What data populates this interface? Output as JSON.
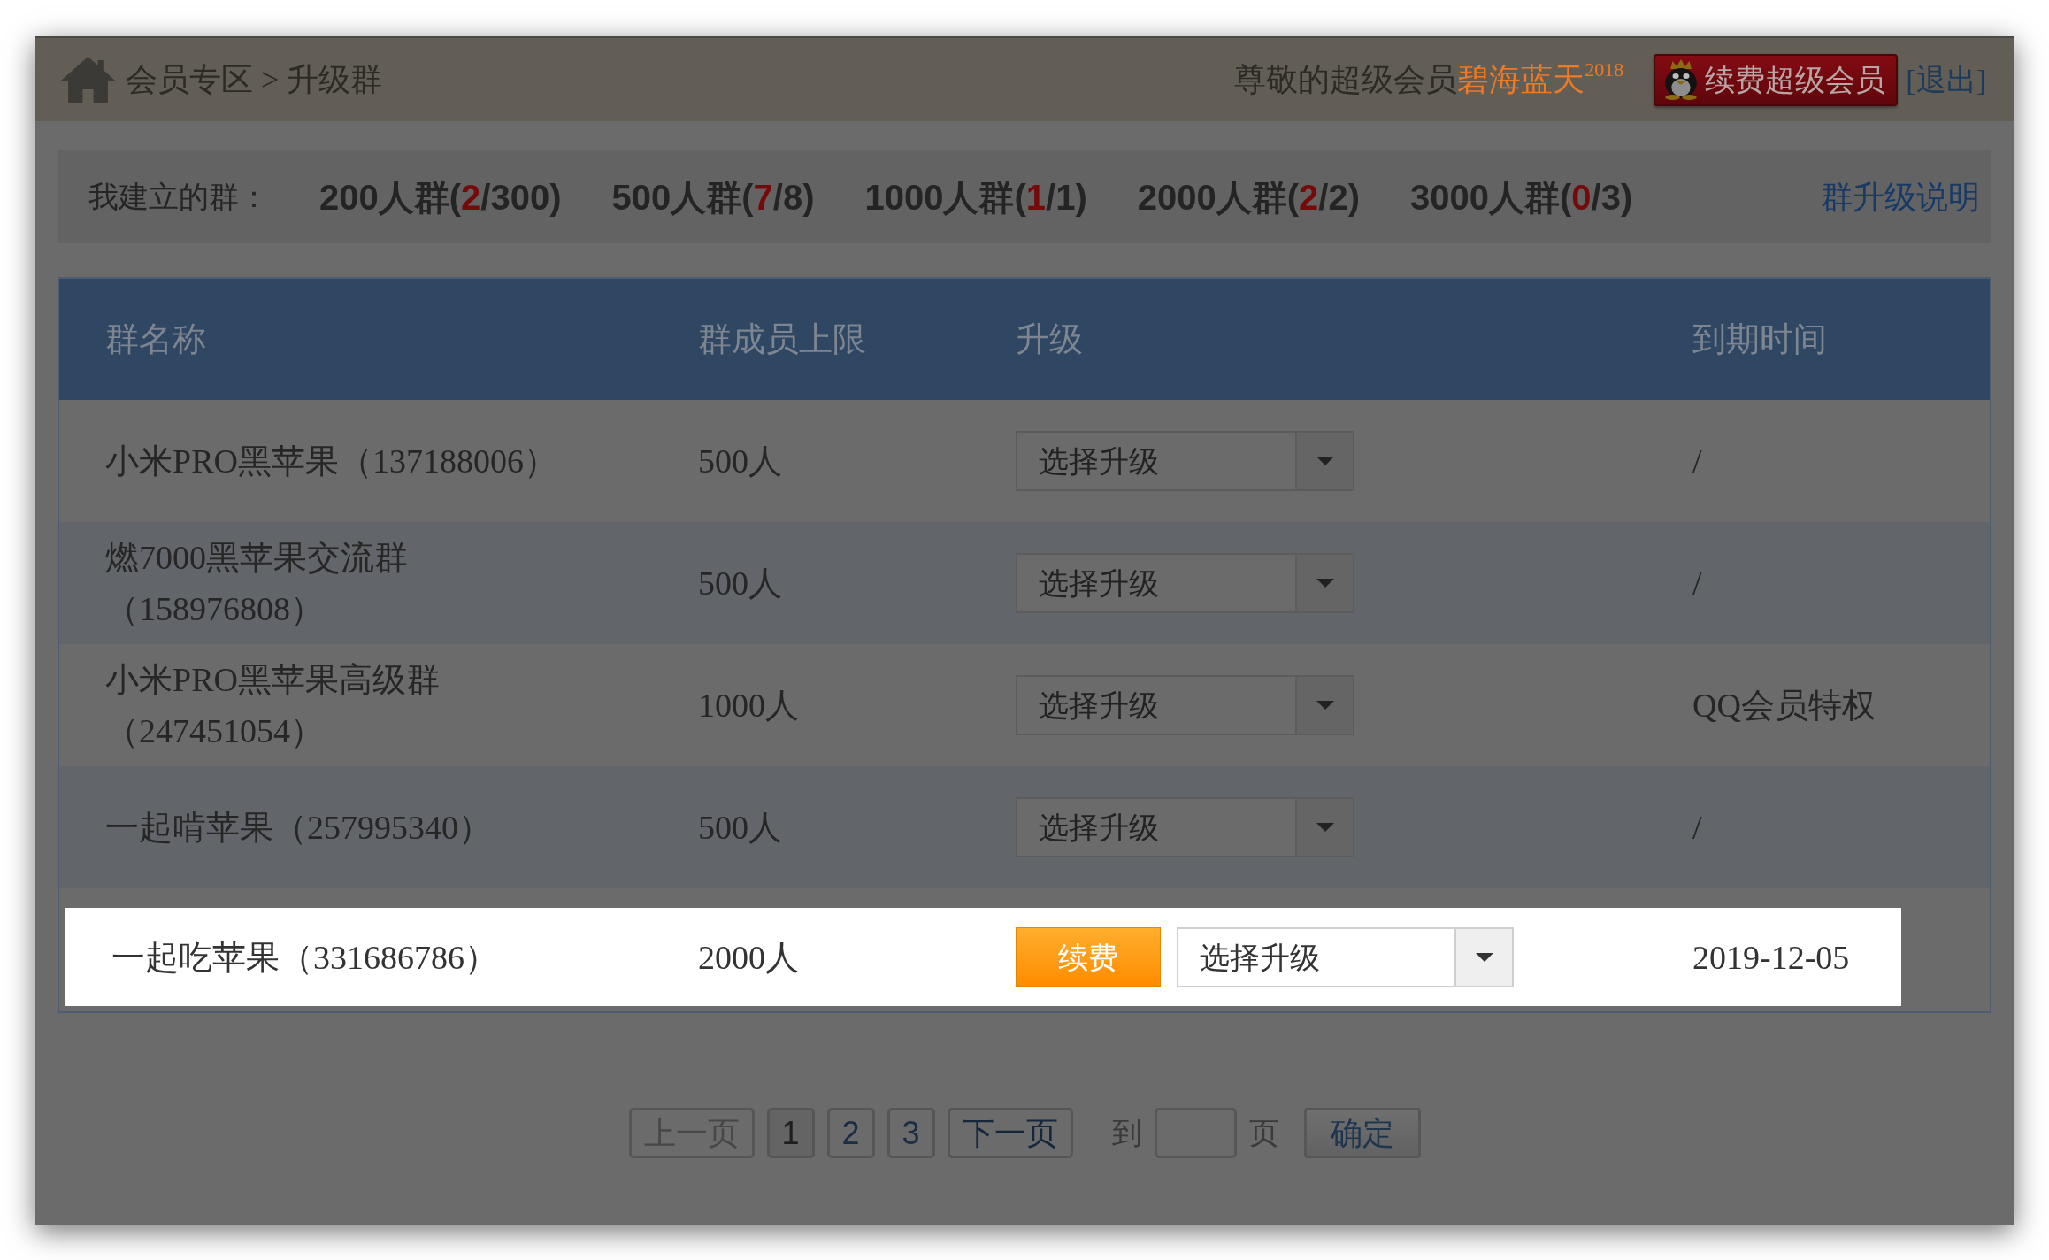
{
  "header": {
    "breadcrumb": "会员专区 > 升级群",
    "greeting": "尊敬的超级会员",
    "member_name": "碧海蓝天$^{2018}$",
    "renew_vip_button": "续费超级会员",
    "logout_link": "[退出]"
  },
  "summary": {
    "label": "我建立的群：",
    "groups": [
      {
        "prefix": "200人群(",
        "used": "2",
        "suffix": "/300)"
      },
      {
        "prefix": "500人群(",
        "used": "7",
        "suffix": "/8)"
      },
      {
        "prefix": "1000人群(",
        "used": "1",
        "suffix": "/1)"
      },
      {
        "prefix": "2000人群(",
        "used": "2",
        "suffix": "/2)"
      },
      {
        "prefix": "3000人群(",
        "used": "0",
        "suffix": "/3)"
      }
    ],
    "help_link": "群升级说明"
  },
  "table": {
    "columns": [
      "群名称",
      "群成员上限",
      "升级",
      "到期时间"
    ],
    "rows": [
      {
        "name": "小米PRO黑苹果（137188006）",
        "limit": "500人",
        "upgrade_select": "选择升级",
        "expiry": "/",
        "highlighted": false
      },
      {
        "name": "燃7000黑苹果交流群（158976808）",
        "limit": "500人",
        "upgrade_select": "选择升级",
        "expiry": "/",
        "highlighted": false
      },
      {
        "name": "小米PRO黑苹果高级群（247451054）",
        "limit": "1000人",
        "upgrade_select": "选择升级",
        "expiry": "QQ会员特权",
        "highlighted": false
      },
      {
        "name": "一起啃苹果（257995340）",
        "limit": "500人",
        "upgrade_select": "选择升级",
        "expiry": "/",
        "highlighted": false
      },
      {
        "name": "一起吃苹果（331686786）",
        "limit": "2000人",
        "renew_button": "续费",
        "upgrade_select": "选择升级",
        "expiry": "2019-12-05",
        "highlighted": true
      }
    ]
  },
  "pagination": {
    "prev": {
      "label": "上一页",
      "disabled": true
    },
    "pages": [
      {
        "label": "1",
        "selected": true
      },
      {
        "label": "2",
        "selected": false
      },
      {
        "label": "3",
        "selected": false
      }
    ],
    "next": {
      "label": "下一页",
      "disabled": false
    },
    "goto_label": "到",
    "page_unit": "页",
    "confirm_button": "确定"
  }
}
